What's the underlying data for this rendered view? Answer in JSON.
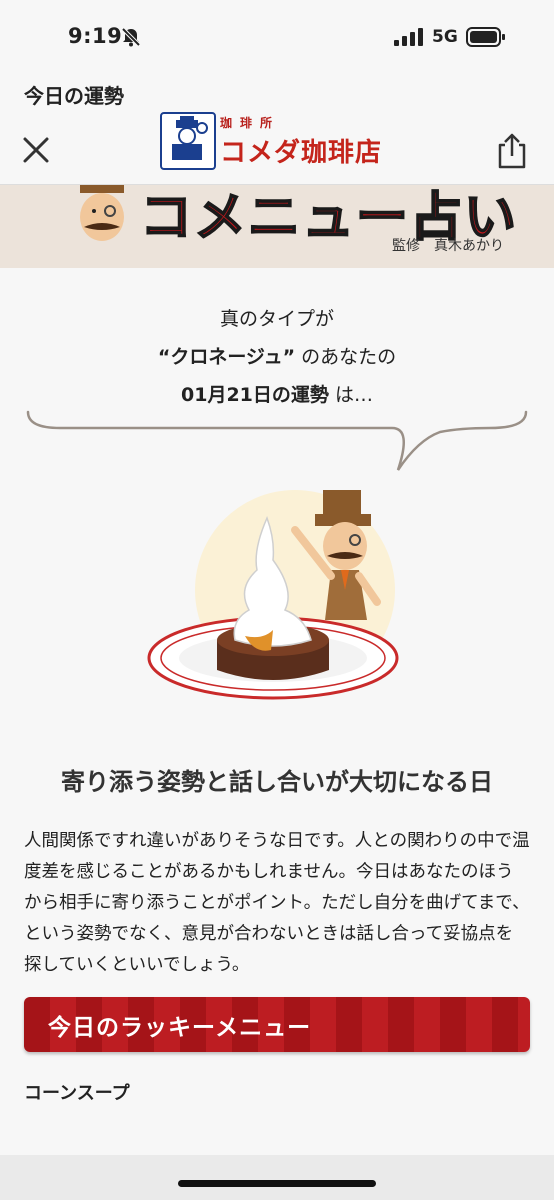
{
  "status": {
    "time": "9:19",
    "network": "5G"
  },
  "nav": {
    "page_title": "今日の運勢"
  },
  "logo": {
    "sub": "珈琲所",
    "main": "コメダ珈琲店"
  },
  "banner": {
    "title": "コメニュー占い",
    "supervisor": "監修　真木あかり"
  },
  "intro": {
    "line1": "真のタイプが",
    "type_name": "“クロネージュ”",
    "line2_suffix": "のあなたの",
    "date_label": "01月21日の運勢",
    "line3_suffix": "は…"
  },
  "fortune": {
    "headline": "寄り添う姿勢と話し合いが大切になる日",
    "body": "人間関係ですれ違いがありそうな日です。人との関わりの中で温度差を感じることがあるかもしれません。今日はあなたのほうから相手に寄り添うことがポイント。ただし自分を曲げてまで、という姿勢でなく、意見が合わないときは話し合って妥協点を探していくといいでしょう。"
  },
  "lucky": {
    "label": "今日のラッキーメニュー",
    "item": "コーンスープ"
  }
}
